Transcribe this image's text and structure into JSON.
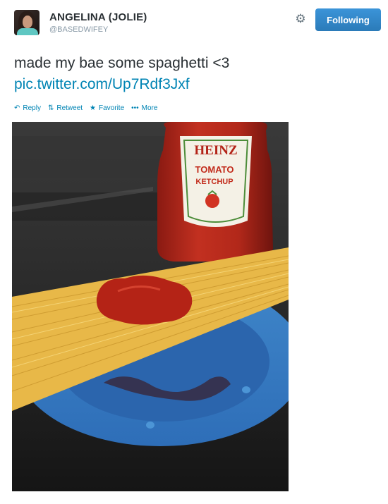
{
  "user": {
    "display_name": "ANGELINA (JOLIE)",
    "handle": "@BASEDWIFEY"
  },
  "header": {
    "follow_label": "Following",
    "accent_color": "#2b7bb9"
  },
  "tweet": {
    "text": "made my bae some spaghetti <3",
    "link": "pic.twitter.com/Up7Rdf3Jxf",
    "link_color": "#0084b4"
  },
  "actions": [
    {
      "icon": "reply-icon",
      "label": "Reply"
    },
    {
      "icon": "retweet-icon",
      "label": "Retweet"
    },
    {
      "icon": "star-icon",
      "label": "Favorite"
    },
    {
      "icon": "more-icon",
      "label": "More"
    }
  ],
  "photo": {
    "bottle_brand": "HEINZ",
    "bottle_label_line1": "TOMATO",
    "bottle_label_line2": "KETCHUP"
  }
}
